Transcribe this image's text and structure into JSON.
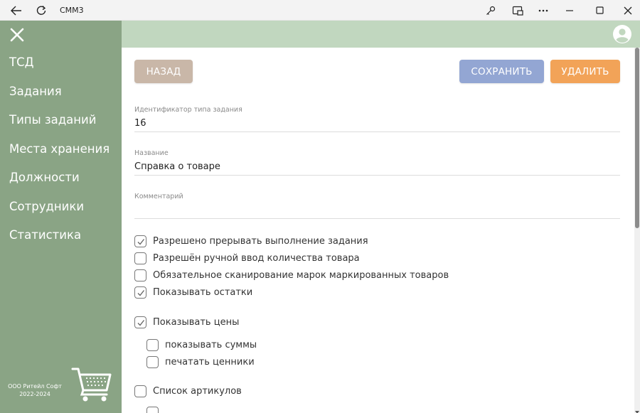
{
  "window": {
    "title": "CMM3"
  },
  "sidebar": {
    "items": [
      {
        "label": "ТСД"
      },
      {
        "label": "Задания"
      },
      {
        "label": "Типы заданий"
      },
      {
        "label": "Места хранения"
      },
      {
        "label": "Должности"
      },
      {
        "label": "Сотрудники"
      },
      {
        "label": "Статистика"
      }
    ],
    "company_name": "ООО Ритейл Софт",
    "company_years": "2022-2024"
  },
  "toolbar": {
    "back_label": "НАЗАД",
    "save_label": "СОХРАНИТЬ",
    "delete_label": "УДАЛИТЬ"
  },
  "form": {
    "task_type_id": {
      "label": "Идентификатор типа задания",
      "value": "16"
    },
    "name": {
      "label": "Название",
      "value": "Справка о товаре"
    },
    "comment": {
      "label": "Комментарий",
      "value": ""
    },
    "checkboxes": [
      {
        "label": "Разрешено прерывать выполнение задания",
        "checked": true
      },
      {
        "label": "Разрешён ручной ввод количества товара",
        "checked": false
      },
      {
        "label": "Обязательное сканирование марок маркированных товаров",
        "checked": false
      },
      {
        "label": "Показывать остатки",
        "checked": true
      },
      {
        "label": "Показывать цены",
        "checked": true
      },
      {
        "label": "показывать суммы",
        "checked": false
      },
      {
        "label": "печатать ценники",
        "checked": false
      },
      {
        "label": "Список артикулов",
        "checked": false
      }
    ]
  },
  "colors": {
    "sidebar_bg": "#8aa485",
    "header_bg": "#c1d7bf",
    "back_button": "#c9b7a8",
    "save_button": "#93a6d3",
    "delete_button": "#f2a358"
  },
  "icons": [
    "back-arrow-icon",
    "refresh-icon",
    "key-icon",
    "cast-icon",
    "more-icon",
    "minimize-icon",
    "maximize-icon",
    "close-icon",
    "close-x-icon",
    "user-avatar-icon",
    "cart-icon",
    "checkmark-icon"
  ]
}
